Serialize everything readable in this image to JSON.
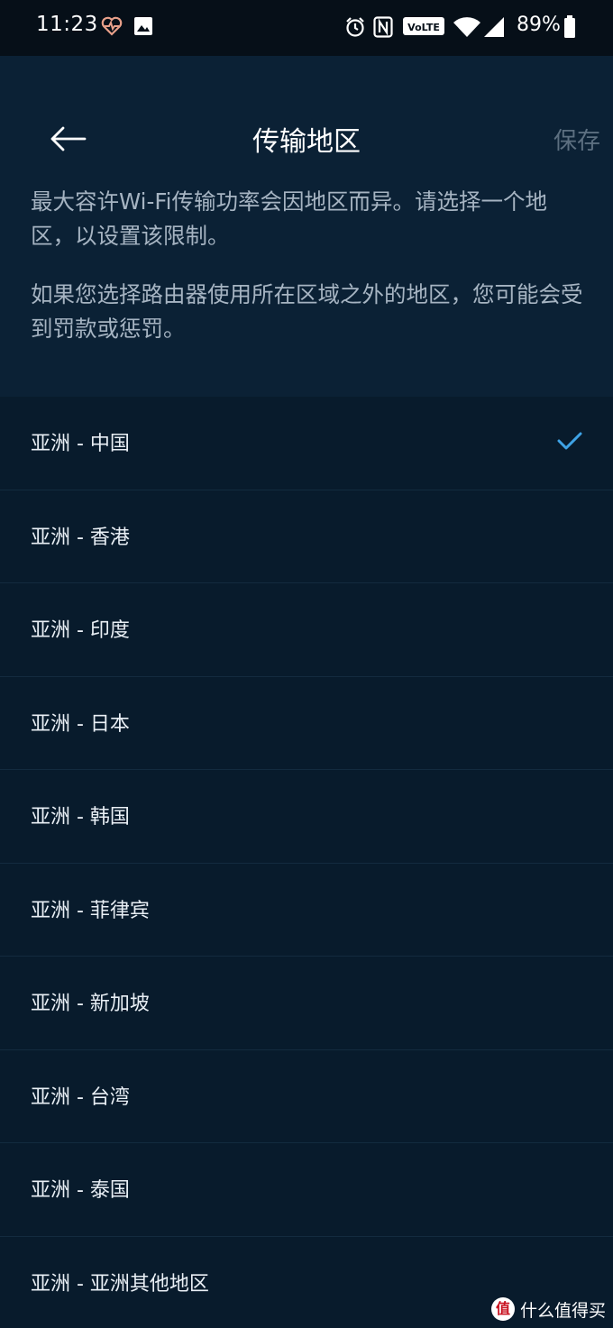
{
  "status": {
    "time": "11:23",
    "battery_pct": "89%",
    "icons": [
      "heart-pulse-icon",
      "image-icon",
      "alarm-icon",
      "nfc-icon",
      "volte-icon",
      "wifi-icon",
      "signal-icon",
      "battery-icon"
    ],
    "volte_text": "VoLTE"
  },
  "header": {
    "title": "传输地区",
    "save_label": "保存"
  },
  "description": {
    "p1": "最大容许Wi-Fi传输功率会因地区而异。请选择一个地区，以设置该限制。",
    "p2": "如果您选择路由器使用所在区域之外的地区，您可能会受到罚款或惩罚。"
  },
  "regions": [
    {
      "label": "亚洲 - 中国",
      "selected": true
    },
    {
      "label": "亚洲 - 香港",
      "selected": false
    },
    {
      "label": "亚洲 - 印度",
      "selected": false
    },
    {
      "label": "亚洲 - 日本",
      "selected": false
    },
    {
      "label": "亚洲 - 韩国",
      "selected": false
    },
    {
      "label": "亚洲 - 菲律宾",
      "selected": false
    },
    {
      "label": "亚洲 - 新加坡",
      "selected": false
    },
    {
      "label": "亚洲 - 台湾",
      "selected": false
    },
    {
      "label": "亚洲 - 泰国",
      "selected": false
    },
    {
      "label": "亚洲 - 亚洲其他地区",
      "selected": false
    }
  ],
  "watermark": {
    "logo_text": "值",
    "text": "什么值得买"
  },
  "colors": {
    "background": "#081b2c",
    "header_bg": "#0b2135",
    "check": "#3ea3e6",
    "heart": "#e8a08a"
  }
}
